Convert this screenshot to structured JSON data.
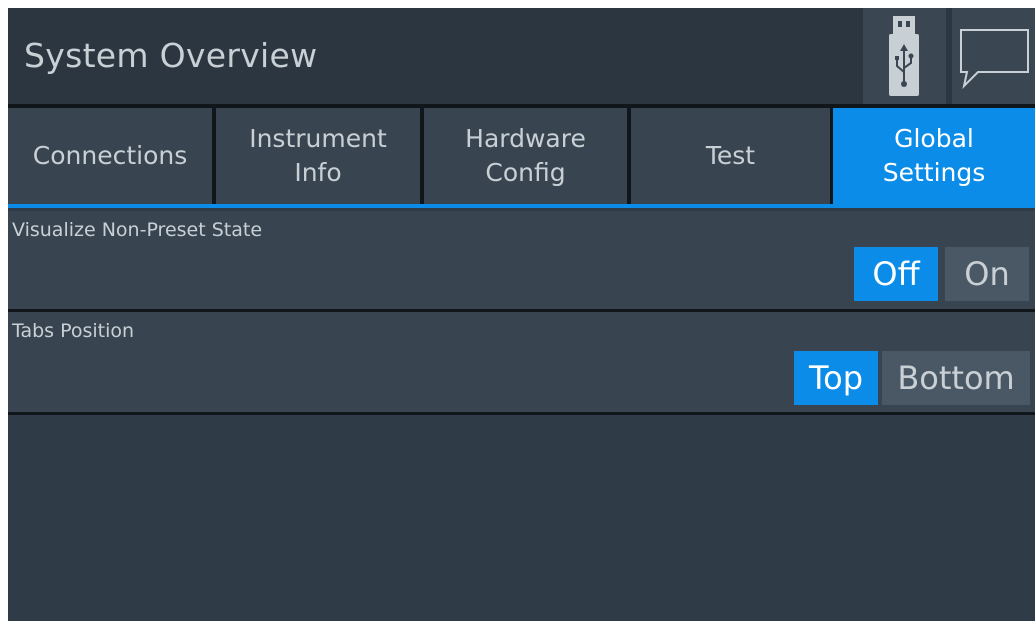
{
  "header": {
    "title": "System Overview",
    "usb_icon": "usb-icon",
    "message_icon": "message-icon"
  },
  "tabs": [
    {
      "label": "Connections",
      "active": false
    },
    {
      "label": "Instrument\nInfo",
      "active": false
    },
    {
      "label": "Hardware\nConfig",
      "active": false
    },
    {
      "label": "Test",
      "active": false
    },
    {
      "label": "Global\nSettings",
      "active": true
    }
  ],
  "settings": {
    "visualize": {
      "label": "Visualize Non-Preset State",
      "options": [
        "Off",
        "On"
      ],
      "selected": "Off"
    },
    "tabs_position": {
      "label": "Tabs Position",
      "options": [
        "Top",
        "Bottom"
      ],
      "selected": "Top"
    }
  },
  "colors": {
    "accent": "#0a8ce8",
    "background": "#2f3c48",
    "panel": "#38444f",
    "text": "#c8cfd5"
  }
}
